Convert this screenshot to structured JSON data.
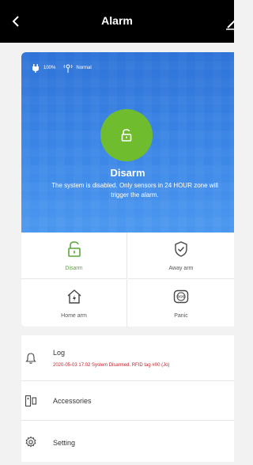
{
  "header": {
    "back_icon": "chevron-left-icon",
    "title": "Alarm",
    "edit_icon": "pencil-icon"
  },
  "panel": {
    "battery": "100%",
    "signal": "Normal",
    "state": "Disarm",
    "description": "The system is disabled. Only sensors in 24 HOUR zone will trigger the alarm.",
    "status_color": "#6fbd2f"
  },
  "modes": [
    {
      "label": "Disarm",
      "icon": "unlock-icon",
      "active": true
    },
    {
      "label": "Away arm",
      "icon": "shield-check-icon",
      "active": false
    },
    {
      "label": "Home arm",
      "icon": "home-lock-icon",
      "active": false
    },
    {
      "label": "Panic",
      "icon": "sos-icon",
      "active": false
    }
  ],
  "menu": {
    "log": {
      "label": "Log",
      "latest": "2020-05-03 17:02 System Disarmed.  RFID tag #00 (Jo)"
    },
    "accessories": {
      "label": "Accessories"
    },
    "setting": {
      "label": "Setting"
    }
  },
  "colors": {
    "accent_green": "#5aa63a",
    "hero_blue": "#3b86e6",
    "log_red": "#c8202a"
  }
}
